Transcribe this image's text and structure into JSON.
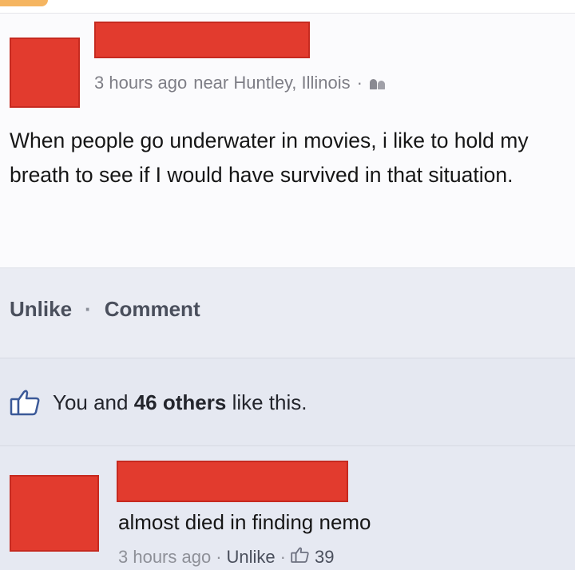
{
  "post": {
    "meta": {
      "time": "3 hours ago",
      "location": "near Huntley, Illinois",
      "separator": "·",
      "audience_icon": "people-icon"
    },
    "text": "When people go underwater in movies, i like to hold my breath to see if I would have survived in that situation."
  },
  "actions": {
    "unlike": "Unlike",
    "separator": "·",
    "comment": "Comment"
  },
  "likes": {
    "icon": "thumbs-up-icon",
    "prefix": "You and",
    "count": "46 others",
    "suffix": "like this."
  },
  "comment": {
    "text": "almost died in finding nemo",
    "time": "3 hours ago",
    "separator": "·",
    "unlike": "Unlike",
    "like_icon": "thumbs-up-icon",
    "like_count": "39"
  },
  "colors": {
    "redaction": "#e23b2e",
    "link": "#4a4f5c",
    "meta": "#7e7e86"
  }
}
